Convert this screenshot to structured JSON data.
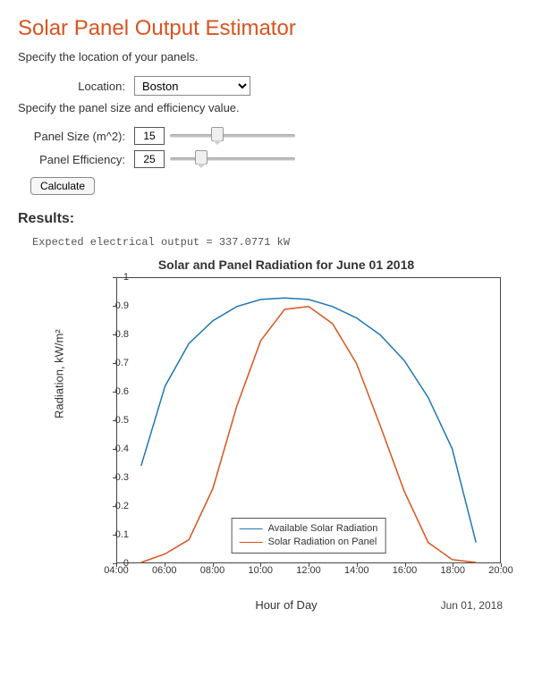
{
  "title": "Solar Panel Output Estimator",
  "intro1": "Specify the location of your panels.",
  "intro2": "Specify the panel size and efficiency value.",
  "labels": {
    "location": "Location:",
    "panel_size": "Panel Size (m^2):",
    "panel_eff": "Panel Efficiency:"
  },
  "location_value": "Boston",
  "panel_size_value": "15",
  "panel_eff_value": "25",
  "calculate_label": "Calculate",
  "results_heading": "Results:",
  "output_text": "Expected electrical output = 337.0771 kW",
  "chart_data": {
    "type": "line",
    "title": "Solar and Panel Radiation for June 01 2018",
    "xlabel": "Hour of Day",
    "ylabel": "Radiation, kW/m²",
    "date_label": "Jun 01, 2018",
    "xticks": [
      "04:00",
      "06:00",
      "08:00",
      "10:00",
      "12:00",
      "14:00",
      "16:00",
      "18:00",
      "20:00"
    ],
    "xlim": [
      4,
      20
    ],
    "ylim": [
      0,
      1
    ],
    "yticks": [
      0,
      0.1,
      0.2,
      0.3,
      0.4,
      0.5,
      0.6,
      0.7,
      0.8,
      0.9,
      1
    ],
    "x": [
      5,
      6,
      7,
      8,
      9,
      10,
      11,
      12,
      13,
      14,
      15,
      16,
      17,
      18,
      19
    ],
    "series": [
      {
        "name": "Available Solar Radiation",
        "color": "#1f77b4",
        "values": [
          0.34,
          0.62,
          0.77,
          0.85,
          0.9,
          0.925,
          0.93,
          0.925,
          0.9,
          0.86,
          0.8,
          0.71,
          0.58,
          0.4,
          0.07
        ]
      },
      {
        "name": "Solar Radiation on Panel",
        "color": "#d9531e",
        "values": [
          0.0,
          0.03,
          0.08,
          0.26,
          0.55,
          0.78,
          0.89,
          0.9,
          0.84,
          0.7,
          0.48,
          0.25,
          0.07,
          0.01,
          0.0
        ]
      }
    ],
    "legend_position": "bottom-center"
  }
}
